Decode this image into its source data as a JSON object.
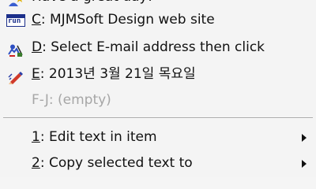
{
  "menu": {
    "items": [
      {
        "prefix_key": "",
        "rest": "Have a great day!",
        "icon": "person-star-icon",
        "partial": true
      },
      {
        "prefix_key": "C",
        "rest": ": MJMSoft Design web site",
        "icon": "run-icon",
        "icon_text": "run"
      },
      {
        "prefix_key": "D",
        "rest": ": Select E-mail address then click",
        "icon": "person-email-icon"
      },
      {
        "prefix_key": "E",
        "rest": ": 2013년 3월 21일 목요일",
        "icon": "pencil-icon"
      },
      {
        "text": "F-J: (empty)",
        "disabled": true
      }
    ],
    "submenu_items": [
      {
        "prefix_key": "1",
        "rest": ": Edit text in item",
        "has_submenu": true
      },
      {
        "prefix_key": "2",
        "rest": ": Copy selected text to",
        "has_submenu": true
      },
      {
        "partial": true,
        "has_submenu": true
      }
    ]
  }
}
